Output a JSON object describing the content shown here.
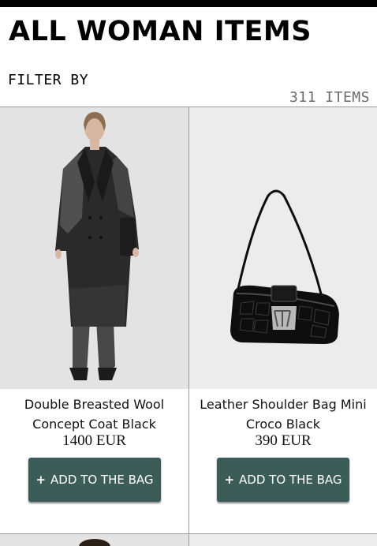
{
  "page": {
    "title": "ALL WOMAN ITEMS",
    "filter_label": "FILTER BY",
    "item_count": "311 ITEMS"
  },
  "products": [
    {
      "name": "Double Breasted Wool Concept Coat Black",
      "price": "1400 EUR",
      "add_label": "ADD TO THE BAG",
      "image_icon": "coat-photo"
    },
    {
      "name": "Leather Shoulder Bag Mini Croco Black",
      "price": "390 EUR",
      "add_label": "ADD TO THE BAG",
      "image_icon": "bag-photo"
    }
  ],
  "colors": {
    "button": "#3c5c57",
    "topbar": "#000000",
    "count_text": "#6b6b6b"
  }
}
